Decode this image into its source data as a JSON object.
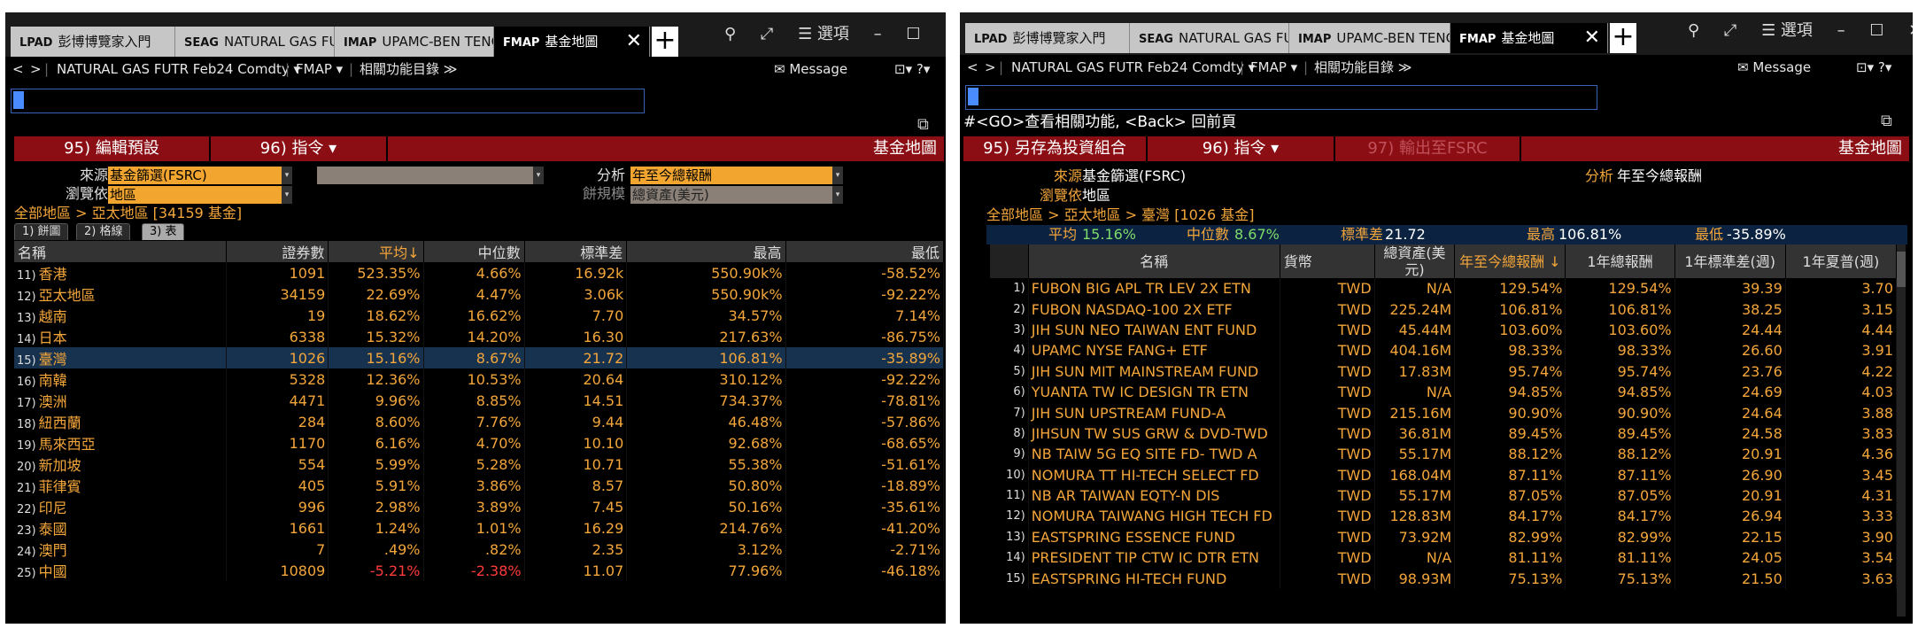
{
  "tabs": [
    {
      "code": "LPAD",
      "label": "彭博博覽家入門"
    },
    {
      "code": "SEAG",
      "label": "NATURAL GAS FU..."
    },
    {
      "code": "IMAP",
      "label": "UPAMC-BEN TENG..."
    },
    {
      "code": "FMAP",
      "label": "基金地圖"
    }
  ],
  "window_controls": {
    "search": "⚲",
    "expand": "⤢",
    "options": "☰ 選項",
    "minimize": "–",
    "maximize": "☐",
    "close": "✕"
  },
  "cmd": {
    "back": "<",
    "forward": ">",
    "security": "NATURAL GAS FUTR Feb24 Comdty ▾",
    "function": "FMAP ▾",
    "related": "相關功能目錄 ≫",
    "message": "✉ Message",
    "icons": "⊡▾ ?▾"
  },
  "left": {
    "toolbar": {
      "preset": "95) 編輯預設",
      "commands": "96) 指令 ▾",
      "title": "基金地圖"
    },
    "source_label": "來源",
    "source_value": "基金篩選(FSRC)",
    "browse_label": "瀏覽依",
    "browse_value": "地區",
    "analysis_label": "分析",
    "analysis_value": "年至今總報酬",
    "pie_label": "餅規模",
    "pie_value": "總資產(美元)",
    "breadcrumb": "全部地區 > 亞太地區 [34159 基金]",
    "view_tabs": [
      "1) 餅圖",
      "2) 格線",
      "3) 表"
    ],
    "columns": [
      "名稱",
      "證券數",
      "平均↓",
      "中位數",
      "標準差",
      "最高",
      "最低"
    ],
    "rows": [
      {
        "n": "11)",
        "name": "香港",
        "count": "1091",
        "avg": "523.35%",
        "median": "4.66%",
        "std": "16.92k",
        "max": "550.90k%",
        "min": "-58.52%"
      },
      {
        "n": "12)",
        "name": "亞太地區",
        "count": "34159",
        "avg": "22.69%",
        "median": "4.47%",
        "std": "3.06k",
        "max": "550.90k%",
        "min": "-92.22%"
      },
      {
        "n": "13)",
        "name": "越南",
        "count": "19",
        "avg": "18.62%",
        "median": "16.62%",
        "std": "7.70",
        "max": "34.57%",
        "min": "7.14%"
      },
      {
        "n": "14)",
        "name": "日本",
        "count": "6338",
        "avg": "15.32%",
        "median": "14.20%",
        "std": "16.30",
        "max": "217.63%",
        "min": "-86.75%"
      },
      {
        "n": "15)",
        "name": "臺灣",
        "count": "1026",
        "avg": "15.16%",
        "median": "8.67%",
        "std": "21.72",
        "max": "106.81%",
        "min": "-35.89%"
      },
      {
        "n": "16)",
        "name": "南韓",
        "count": "5328",
        "avg": "12.36%",
        "median": "10.53%",
        "std": "20.64",
        "max": "310.12%",
        "min": "-92.22%"
      },
      {
        "n": "17)",
        "name": "澳洲",
        "count": "4471",
        "avg": "9.96%",
        "median": "8.85%",
        "std": "14.51",
        "max": "734.37%",
        "min": "-78.81%"
      },
      {
        "n": "18)",
        "name": "紐西蘭",
        "count": "284",
        "avg": "8.60%",
        "median": "7.76%",
        "std": "9.44",
        "max": "46.48%",
        "min": "-57.86%"
      },
      {
        "n": "19)",
        "name": "馬來西亞",
        "count": "1170",
        "avg": "6.16%",
        "median": "4.70%",
        "std": "10.10",
        "max": "92.68%",
        "min": "-68.65%"
      },
      {
        "n": "20)",
        "name": "新加坡",
        "count": "554",
        "avg": "5.99%",
        "median": "5.28%",
        "std": "10.71",
        "max": "55.38%",
        "min": "-51.61%"
      },
      {
        "n": "21)",
        "name": "菲律賓",
        "count": "405",
        "avg": "5.91%",
        "median": "3.86%",
        "std": "8.57",
        "max": "50.80%",
        "min": "-18.89%"
      },
      {
        "n": "22)",
        "name": "印尼",
        "count": "996",
        "avg": "2.98%",
        "median": "3.89%",
        "std": "7.45",
        "max": "50.16%",
        "min": "-35.61%"
      },
      {
        "n": "23)",
        "name": "泰國",
        "count": "1661",
        "avg": "1.24%",
        "median": "1.01%",
        "std": "16.29",
        "max": "214.76%",
        "min": "-41.20%"
      },
      {
        "n": "24)",
        "name": "澳門",
        "count": "7",
        "avg": ".49%",
        "median": ".82%",
        "std": "2.35",
        "max": "3.12%",
        "min": "-2.71%"
      },
      {
        "n": "25)",
        "name": "中國",
        "count": "10809",
        "avg": "-5.21%",
        "median": "-2.38%",
        "std": "11.07",
        "max": "77.96%",
        "min": "-46.18%"
      }
    ]
  },
  "right": {
    "hint": "#<GO>查看相關功能, <Back> 回前頁",
    "toolbar": {
      "save": "95) 另存為投資組合",
      "commands": "96) 指令 ▾",
      "export": "97) 輸出至FSRC",
      "title": "基金地圖"
    },
    "source_label": "來源",
    "source_value": "基金篩選(FSRC)",
    "browse_label": "瀏覽依",
    "browse_value": "地區",
    "analysis_label": "分析",
    "analysis_value": "年至今總報酬",
    "breadcrumb": "全部地區 > 亞太地區 > 臺灣 [1026 基金]",
    "stats": {
      "avg_label": "平均",
      "avg": "15.16%",
      "median_label": "中位數",
      "median": "8.67%",
      "std_label": "標準差",
      "std": "21.72",
      "max_label": "最高",
      "max": "106.81%",
      "min_label": "最低",
      "min": "-35.89%"
    },
    "columns": [
      "名稱",
      "貨幣",
      "總資產(美元)",
      "年至今總報酬 ↓",
      "1年總報酬",
      "1年標準差(週)",
      "1年夏普(週)"
    ],
    "rows": [
      {
        "n": "1)",
        "name": "FUBON BIG APL TR LEV 2X ETN",
        "cur": "TWD",
        "aum": "N/A",
        "ytd": "129.54%",
        "r1": "129.54%",
        "sd": "39.39",
        "sh": "3.70"
      },
      {
        "n": "2)",
        "name": "FUBON NASDAQ-100 2X ETF",
        "cur": "TWD",
        "aum": "225.24M",
        "ytd": "106.81%",
        "r1": "106.81%",
        "sd": "38.25",
        "sh": "3.15"
      },
      {
        "n": "3)",
        "name": "JIH SUN NEO TAIWAN ENT FUND",
        "cur": "TWD",
        "aum": "45.44M",
        "ytd": "103.60%",
        "r1": "103.60%",
        "sd": "24.44",
        "sh": "4.44"
      },
      {
        "n": "4)",
        "name": "UPAMC NYSE FANG+ ETF",
        "cur": "TWD",
        "aum": "404.16M",
        "ytd": "98.33%",
        "r1": "98.33%",
        "sd": "26.60",
        "sh": "3.91"
      },
      {
        "n": "5)",
        "name": "JIH SUN MIT MAINSTREAM FUND",
        "cur": "TWD",
        "aum": "17.83M",
        "ytd": "95.74%",
        "r1": "95.74%",
        "sd": "23.76",
        "sh": "4.22"
      },
      {
        "n": "6)",
        "name": "YUANTA TW IC DESIGN TR ETN",
        "cur": "TWD",
        "aum": "N/A",
        "ytd": "94.85%",
        "r1": "94.85%",
        "sd": "24.69",
        "sh": "4.03"
      },
      {
        "n": "7)",
        "name": "JIH SUN UPSTREAM FUND-A",
        "cur": "TWD",
        "aum": "215.16M",
        "ytd": "90.90%",
        "r1": "90.90%",
        "sd": "24.64",
        "sh": "3.88"
      },
      {
        "n": "8)",
        "name": "JIHSUN TW SUS GRW & DVD-TWD",
        "cur": "TWD",
        "aum": "36.81M",
        "ytd": "89.45%",
        "r1": "89.45%",
        "sd": "24.58",
        "sh": "3.83"
      },
      {
        "n": "9)",
        "name": "NB TAIW 5G EQ SITE FD- TWD A",
        "cur": "TWD",
        "aum": "55.17M",
        "ytd": "88.12%",
        "r1": "88.12%",
        "sd": "20.91",
        "sh": "4.36"
      },
      {
        "n": "10)",
        "name": "NOMURA TT HI-TECH SELECT FD",
        "cur": "TWD",
        "aum": "168.04M",
        "ytd": "87.11%",
        "r1": "87.11%",
        "sd": "26.90",
        "sh": "3.45"
      },
      {
        "n": "11)",
        "name": "NB AR TAIWAN EQTY-N DIS",
        "cur": "TWD",
        "aum": "55.17M",
        "ytd": "87.05%",
        "r1": "87.05%",
        "sd": "20.91",
        "sh": "4.31"
      },
      {
        "n": "12)",
        "name": "NOMURA TAIWANG HIGH TECH FD",
        "cur": "TWD",
        "aum": "128.83M",
        "ytd": "84.17%",
        "r1": "84.17%",
        "sd": "26.94",
        "sh": "3.33"
      },
      {
        "n": "13)",
        "name": "EASTSPRING ESSENCE FUND",
        "cur": "TWD",
        "aum": "73.92M",
        "ytd": "82.99%",
        "r1": "82.99%",
        "sd": "22.15",
        "sh": "3.90"
      },
      {
        "n": "14)",
        "name": "PRESIDENT TIP CTW IC DTR ETN",
        "cur": "TWD",
        "aum": "N/A",
        "ytd": "81.11%",
        "r1": "81.11%",
        "sd": "24.05",
        "sh": "3.54"
      },
      {
        "n": "15)",
        "name": "EASTSPRING HI-TECH FUND",
        "cur": "TWD",
        "aum": "98.93M",
        "ytd": "75.13%",
        "r1": "75.13%",
        "sd": "21.50",
        "sh": "3.63"
      }
    ]
  }
}
